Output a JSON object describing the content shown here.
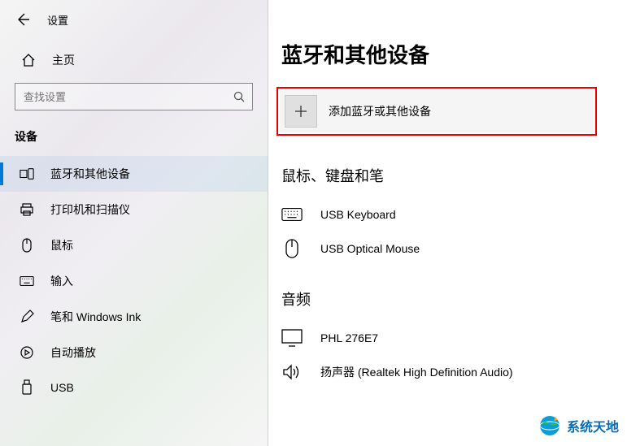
{
  "header": {
    "settings_title": "设置"
  },
  "sidebar": {
    "home_label": "主页",
    "search_placeholder": "查找设置",
    "section_label": "设备",
    "items": [
      {
        "label": "蓝牙和其他设备"
      },
      {
        "label": "打印机和扫描仪"
      },
      {
        "label": "鼠标"
      },
      {
        "label": "输入"
      },
      {
        "label": "笔和 Windows Ink"
      },
      {
        "label": "自动播放"
      },
      {
        "label": "USB"
      }
    ]
  },
  "main": {
    "title": "蓝牙和其他设备",
    "add_label": "添加蓝牙或其他设备",
    "section_mouse_keyboard": {
      "title": "鼠标、键盘和笔",
      "devices": [
        {
          "label": "USB Keyboard"
        },
        {
          "label": "USB Optical Mouse"
        }
      ]
    },
    "section_audio": {
      "title": "音频",
      "devices": [
        {
          "label": "PHL 276E7"
        },
        {
          "label": "扬声器 (Realtek High Definition Audio)"
        }
      ]
    }
  },
  "watermark": {
    "text": "系统天地"
  }
}
